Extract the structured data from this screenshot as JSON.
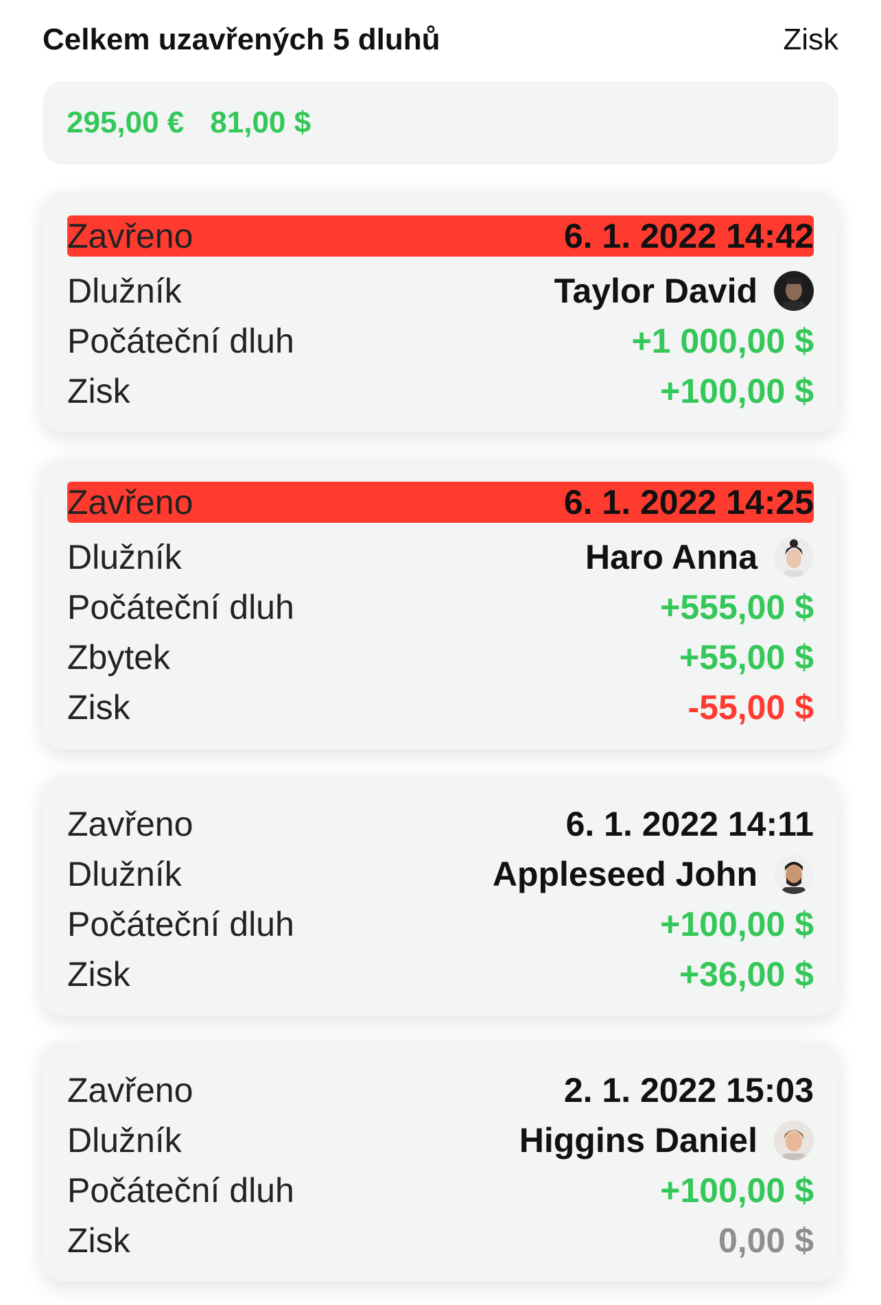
{
  "header": {
    "title": "Celkem uzavřených 5 dluhů",
    "right": "Zisk"
  },
  "totals": {
    "eur": "295,00 €",
    "usd": "81,00 $"
  },
  "cards": [
    {
      "closed_label": "Zavřeno",
      "closed_value": "6. 1. 2022 14:42",
      "debtor_label": "Dlužník",
      "debtor_name": "Taylor David",
      "initial_label": "Počáteční dluh",
      "initial_value": "+1 000,00 $",
      "profit_label": "Zisk",
      "profit_value": "+100,00 $"
    },
    {
      "closed_label": "Zavřeno",
      "closed_value": "6. 1. 2022 14:25",
      "debtor_label": "Dlužník",
      "debtor_name": "Haro Anna",
      "initial_label": "Počáteční dluh",
      "initial_value": "+555,00 $",
      "rest_label": "Zbytek",
      "rest_value": "+55,00 $",
      "profit_label": "Zisk",
      "profit_value": "-55,00 $"
    },
    {
      "closed_label": "Zavřeno",
      "closed_value": "6. 1. 2022 14:11",
      "debtor_label": "Dlužník",
      "debtor_name": "Appleseed John",
      "initial_label": "Počáteční dluh",
      "initial_value": "+100,00 $",
      "profit_label": "Zisk",
      "profit_value": "+36,00 $"
    },
    {
      "closed_label": "Zavřeno",
      "closed_value": "2. 1. 2022 15:03",
      "debtor_label": "Dlužník",
      "debtor_name": "Higgins Daniel",
      "initial_label": "Počáteční dluh",
      "initial_value": "+100,00 $",
      "profit_label": "Zisk",
      "profit_value": "0,00 $"
    }
  ],
  "colors": {
    "green": "#34c759",
    "red": "#ff3b30",
    "gray": "#8e8e93",
    "card_bg": "#f3f4f4"
  }
}
